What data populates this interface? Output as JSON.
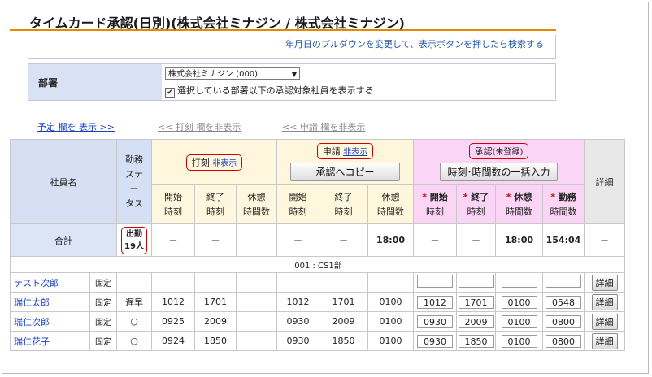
{
  "page": {
    "title": "タイムカード承認(日別)(株式会社ミナジン / 株式会社ミナジン)",
    "info": "年月日のプルダウンを変更して、表示ボタンを押したら検索する"
  },
  "filter": {
    "label": "部署",
    "select_value": "株式会社ミナジン (000)",
    "checkbox_label": "選択している部署以下の承認対象社員を表示する",
    "checked": true
  },
  "links": {
    "show_schedule": "予定 欄を 表示 >>",
    "hide_punch": "<< 打刻 欄を非表示",
    "hide_request": "<< 申請 欄を非表示"
  },
  "table": {
    "col_name": "社員名",
    "col_status_lines": [
      "勤務",
      "ステ",
      "ー",
      "タス"
    ],
    "punch_group": "打刻",
    "punch_hide": "非表示",
    "request_group": "申請",
    "request_hide": "非表示",
    "copy_button": "承認へコピー",
    "approve_group": "承認",
    "approve_state": "(未登録)",
    "bulk_button": "時刻･時間数の一括入力",
    "col_detail": "詳細",
    "sub_start": [
      "開始",
      "時刻"
    ],
    "sub_end": [
      "終了",
      "時刻"
    ],
    "sub_break": [
      "休憩",
      "時間数"
    ],
    "sub_work": [
      "勤務",
      "時間数"
    ],
    "total_label": "合計",
    "total_status_lines": [
      "出勤",
      "19人"
    ],
    "total_values": {
      "punch_start": "－",
      "punch_end": "－",
      "punch_break": "",
      "req_start": "－",
      "req_end": "－",
      "req_break": "18:00",
      "app_start": "－",
      "app_end": "－",
      "app_break": "18:00",
      "app_work": "154:04",
      "detail": "－"
    },
    "dept": "001 : CS1部",
    "fixed_label": "固定",
    "detail_button": "詳細",
    "rows": [
      {
        "name": "テスト次郎",
        "fixed": "固定",
        "status": "",
        "p_start": "",
        "p_end": "",
        "p_break": "",
        "r_start": "",
        "r_end": "",
        "r_break": "",
        "a_start": "",
        "a_end": "",
        "a_break": "",
        "a_work": ""
      },
      {
        "name": "瑞仁太郎",
        "fixed": "固定",
        "status": "遅早",
        "p_start": "1012",
        "p_end": "1701",
        "p_break": "",
        "r_start": "1012",
        "r_end": "1701",
        "r_break": "0100",
        "a_start": "1012",
        "a_end": "1701",
        "a_break": "0100",
        "a_work": "0548"
      },
      {
        "name": "瑞仁次郎",
        "fixed": "固定",
        "status": "○",
        "p_start": "0925",
        "p_end": "2009",
        "p_break": "",
        "r_start": "0930",
        "r_end": "2009",
        "r_break": "0100",
        "a_start": "0930",
        "a_end": "2009",
        "a_break": "0100",
        "a_work": "0800"
      },
      {
        "name": "瑞仁花子",
        "fixed": "固定",
        "status": "○",
        "p_start": "0924",
        "p_end": "1850",
        "p_break": "",
        "r_start": "0930",
        "r_end": "1850",
        "r_break": "0100",
        "a_start": "0930",
        "a_end": "1850",
        "a_break": "0100",
        "a_work": "0800"
      }
    ]
  }
}
